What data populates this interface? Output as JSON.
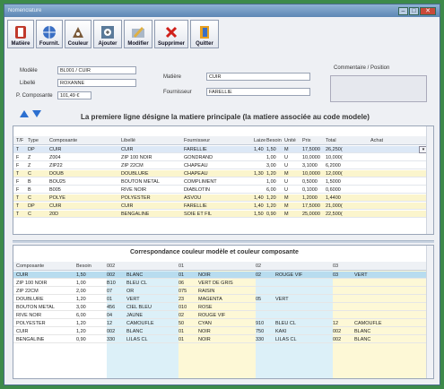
{
  "window": {
    "title": "Nomenclature"
  },
  "toolbar": [
    {
      "label": "Matière",
      "icon": "spool-icon",
      "name": "matiere-button",
      "w": "w1"
    },
    {
      "label": "Fournit.",
      "icon": "globe-icon",
      "name": "fournit-button",
      "w": "w1"
    },
    {
      "label": "Couleur",
      "icon": "palette-icon",
      "name": "couleur-button",
      "w": "w1"
    },
    {
      "label": "Ajouter",
      "icon": "add-icon",
      "name": "ajouter-button",
      "w": "w2"
    },
    {
      "label": "Modifier",
      "icon": "edit-icon",
      "name": "modifier-button",
      "w": "w2"
    },
    {
      "label": "Supprimer",
      "icon": "delete-icon",
      "name": "supprimer-button",
      "w": "w3"
    },
    {
      "label": "Quitter",
      "icon": "exit-door-icon",
      "name": "quitter-button",
      "w": "w2"
    }
  ],
  "form": {
    "modele_label": "Modèle",
    "modele_value": "BL001 / CUIR",
    "libelle_label": "Libellé",
    "libelle_value": "ROXANNE",
    "pcomposante_label": "P. Composante",
    "pcomposante_value": "101,49 €",
    "matiere_label": "Matière",
    "matiere_value": "CUIR",
    "fournisseur_label": "Fournisseur",
    "fournisseur_value": "FARELLIE",
    "comment_label": "Commentaire / Position"
  },
  "info_text": "La premiere ligne désigne la matiere principale (la matiere associée au code modele)",
  "grid1": {
    "headers": [
      "T/F",
      "Type",
      "Composante",
      "Libellé",
      "Fournisseur",
      "Laize",
      "Besoin",
      "Unité",
      "Prix",
      "Total",
      "Achat"
    ],
    "rows": [
      {
        "style": "selected",
        "cells": [
          "T",
          "DP",
          "CUIR",
          "CUIR",
          "FARELLIE",
          "1,40",
          "1,50",
          "M",
          "17,5000",
          "26,250("
        ]
      },
      {
        "style": "white",
        "cells": [
          "F",
          "Z",
          "Z004",
          "ZIP 100 NOIR",
          "GONDRAND",
          "",
          "1,00",
          "U",
          "10,0000",
          "10,000("
        ]
      },
      {
        "style": "white",
        "cells": [
          "F",
          "Z",
          "ZIP22",
          "ZIP 22CM",
          "CHAPEAU",
          "",
          "3,00",
          "U",
          "3,1000",
          "6,2000"
        ]
      },
      {
        "style": "yellow",
        "cells": [
          "T",
          "C",
          "DOUB",
          "DOUBLURE",
          "CHAPEAU",
          "1,30",
          "1,20",
          "M",
          "10,0000",
          "12,000("
        ]
      },
      {
        "style": "white",
        "cells": [
          "F",
          "B",
          "BOU25",
          "BOUTON METAL",
          "COMPLIMENT",
          "",
          "1,00",
          "U",
          "0,5000",
          "1,5000"
        ]
      },
      {
        "style": "white",
        "cells": [
          "F",
          "B",
          "B005",
          "RIVE NOIR",
          "DIABLOTIN",
          "",
          "6,00",
          "U",
          "0,1000",
          "0,6000"
        ]
      },
      {
        "style": "yellow",
        "cells": [
          "T",
          "C",
          "POLYE",
          "POLYESTER",
          "ASVOU",
          "1,40",
          "1,20",
          "M",
          "1,2000",
          "1,4400"
        ]
      },
      {
        "style": "yellow",
        "cells": [
          "T",
          "DP",
          "CUIR",
          "CUIR",
          "FARELLIE",
          "1,40",
          "1,20",
          "M",
          "17,5000",
          "21,000("
        ]
      },
      {
        "style": "yellow",
        "cells": [
          "T",
          "C",
          "20D",
          "BENGALINE",
          "SOIE ET FIL",
          "1,50",
          "0,90",
          "M",
          "25,0000",
          "22,500("
        ]
      }
    ]
  },
  "grid2": {
    "title": "Correspondance couleur modèle et couleur composante",
    "headers": [
      "Composante",
      "Besoin",
      "002",
      "",
      "01",
      "",
      "02",
      "",
      "03",
      ""
    ],
    "rows": [
      [
        "CUIR",
        "1,50",
        "002",
        "BLANC",
        "01",
        "NOIR",
        "02",
        "ROUGE VIF",
        "03",
        "VERT"
      ],
      [
        "ZIP 100 NOIR",
        "1,00",
        "B10",
        "BLEU CL",
        "06",
        "VERT DE GRIS",
        "",
        "",
        "",
        ""
      ],
      [
        "ZIP 22CM",
        "2,00",
        "07",
        "OR",
        "075",
        "RAISIN",
        "",
        "",
        "",
        ""
      ],
      [
        "DOUBLURE",
        "1,20",
        "01",
        "VERT",
        "23",
        "MAGENTA",
        "05",
        "VERT",
        "",
        ""
      ],
      [
        "BOUTON METAL",
        "3,00",
        "456",
        "CIEL BLEU",
        "010",
        "ROSE",
        "",
        "",
        "",
        ""
      ],
      [
        "RIVE NOIR",
        "6,00",
        "04",
        "JAUNE",
        "02",
        "ROUGE VIF",
        "",
        "",
        "",
        ""
      ],
      [
        "POLYESTER",
        "1,20",
        "12",
        "CAMOUFLE",
        "50",
        "CYAN",
        "910",
        "BLEU CL",
        "12",
        "CAMOUFLE"
      ],
      [
        "CUIR",
        "1,20",
        "002",
        "BLANC",
        "01",
        "NOIR",
        "750",
        "KAKI",
        "002",
        "BLANC"
      ],
      [
        "BENGALINE",
        "0,90",
        "330",
        "LILAS CL",
        "01",
        "NOIR",
        "330",
        "LILAS CL",
        "002",
        "BLANC"
      ]
    ]
  }
}
